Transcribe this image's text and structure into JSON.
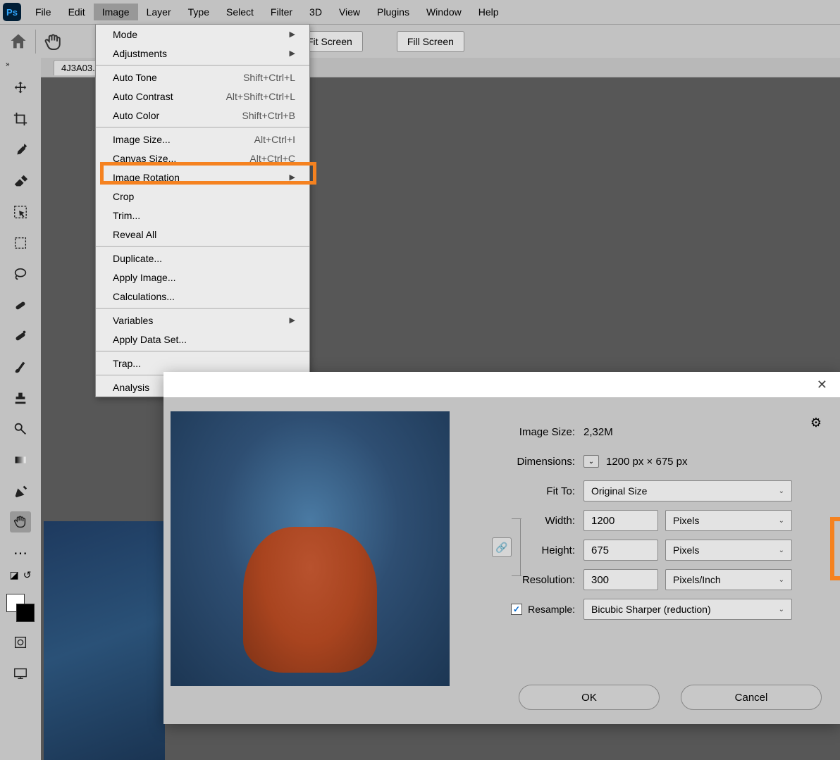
{
  "menubar": [
    "File",
    "Edit",
    "Image",
    "Layer",
    "Type",
    "Select",
    "Filter",
    "3D",
    "View",
    "Plugins",
    "Window",
    "Help"
  ],
  "options": {
    "fit_screen": "Fit Screen",
    "fill_screen": "Fill Screen"
  },
  "doc_tab": "4J3A03.",
  "dropdown": {
    "groups": [
      [
        {
          "label": "Mode",
          "arrow": true
        },
        {
          "label": "Adjustments",
          "arrow": true
        }
      ],
      [
        {
          "label": "Auto Tone",
          "shortcut": "Shift+Ctrl+L"
        },
        {
          "label": "Auto Contrast",
          "shortcut": "Alt+Shift+Ctrl+L"
        },
        {
          "label": "Auto Color",
          "shortcut": "Shift+Ctrl+B"
        }
      ],
      [
        {
          "label": "Image Size...",
          "shortcut": "Alt+Ctrl+I"
        },
        {
          "label": "Canvas Size...",
          "shortcut": "Alt+Ctrl+C"
        },
        {
          "label": "Image Rotation",
          "arrow": true
        },
        {
          "label": "Crop"
        },
        {
          "label": "Trim..."
        },
        {
          "label": "Reveal All"
        }
      ],
      [
        {
          "label": "Duplicate..."
        },
        {
          "label": "Apply Image..."
        },
        {
          "label": "Calculations..."
        }
      ],
      [
        {
          "label": "Variables",
          "arrow": true
        },
        {
          "label": "Apply Data Set..."
        }
      ],
      [
        {
          "label": "Trap..."
        }
      ],
      [
        {
          "label": "Analysis",
          "arrow": true
        }
      ]
    ]
  },
  "dialog": {
    "image_size_label": "Image Size:",
    "image_size_value": "2,32M",
    "dimensions_label": "Dimensions:",
    "dimensions_value": "1200 px  ×  675 px",
    "fit_to_label": "Fit To:",
    "fit_to_value": "Original Size",
    "width_label": "Width:",
    "width_value": "1200",
    "width_unit": "Pixels",
    "height_label": "Height:",
    "height_value": "675",
    "height_unit": "Pixels",
    "resolution_label": "Resolution:",
    "resolution_value": "300",
    "resolution_unit": "Pixels/Inch",
    "resample_label": "Resample:",
    "resample_value": "Bicubic Sharper (reduction)",
    "ok": "OK",
    "cancel": "Cancel"
  },
  "logo": "Ps"
}
